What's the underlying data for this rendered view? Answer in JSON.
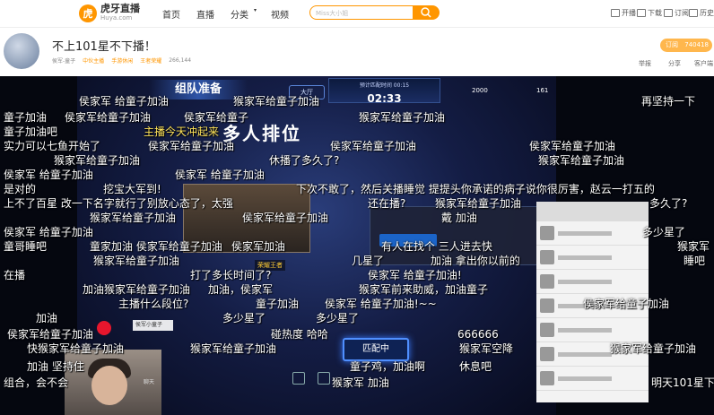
{
  "topnav": {
    "logo_cn": "虎牙直播",
    "logo_en": "Huya.com",
    "items": [
      "首页",
      "直播",
      "分类",
      "视频"
    ],
    "search_placeholder": "Miss大小姐",
    "right": [
      "开播",
      "下载",
      "订阅",
      "历史"
    ]
  },
  "room": {
    "title": "不上101星不下播！",
    "streamer": "侯军-童子",
    "tag_mid": "中伙主播",
    "cat1": "手游休闲",
    "cat2": "王者荣耀",
    "viewers": "266,144",
    "subscribe_label": "订阅",
    "subscribe_count": "740418",
    "tools": [
      "举报",
      "分享",
      "客户端"
    ]
  },
  "game": {
    "team_banner": "组队准备",
    "timer_label": "预计匹配时间 00:15",
    "timer": "02:33",
    "mode_btn": "大厅",
    "stat_coins": "2000",
    "stat_gems": "161",
    "mode_banner": "多人排位",
    "rank_badge": "荣耀王者",
    "match_btn": "匹配中",
    "streamer_tag": "侯军小童子",
    "chat_hint": "聊天"
  },
  "danmaku": [
    "侯家军 给童子加油",
    "猴家军给童子加油",
    "童子加油",
    "童子加油吧",
    "侯家军给童子加油",
    "侯家军给童子",
    "猴家军给童子加油",
    "主播今天冲起来",
    "再坚持一下",
    "多人排位",
    "实力可以七鱼开始了",
    "侯家军给童子加油",
    "休播了多久了?",
    "侯家军给童子加油",
    "侯家军给童子加油",
    "侯家军 给童子加油",
    "猴家军给童子加油",
    "侯家军 给童子加油",
    "猴家军给童子加油",
    "下次不敢了，然后关播睡觉 提提头你承诺的病子说你很厉害，赵云一打五的",
    "是对的",
    "挖宝大军到!",
    "上不了百星 改一下名字就行了别放心态了，太强",
    "还在播?",
    "猴家军给童子加油",
    "戴 加油",
    "多久了?",
    "侯家军 给童子加油",
    "猴家军给童子加油",
    "侯家军给童子加油",
    "多少星了",
    "童哥睡吧",
    "童家加油 侯家军给童子加油",
    "侯家军加油",
    "有人在找个 三人进去快",
    "猴家军",
    "猴家军给童子加油",
    "几星了",
    "加油 拿出你以前的",
    "睡吧",
    "在播",
    "打了多长时间了?",
    "侯家军 给童子加油!",
    "加油猴家军给童子加油",
    "加油，侯家军",
    "猴家军前来助威，加油童子",
    "主播什么段位?",
    "童子加油",
    "侯家军 给童子加油!~~",
    "侯家军给童子加油",
    "加油",
    "多少星了",
    "多少星了",
    "侯家军给童子加油",
    "碰热度 哈哈",
    "666666",
    "猴家军给童子加油",
    "快猴家军给童子加油",
    "猴家军给童子加油",
    "猴家军空降",
    "加油 坚持住",
    "童子鸡，加油啊",
    "休息吧",
    "组合，会不会",
    "猴家军 加油",
    "明天101星下"
  ]
}
